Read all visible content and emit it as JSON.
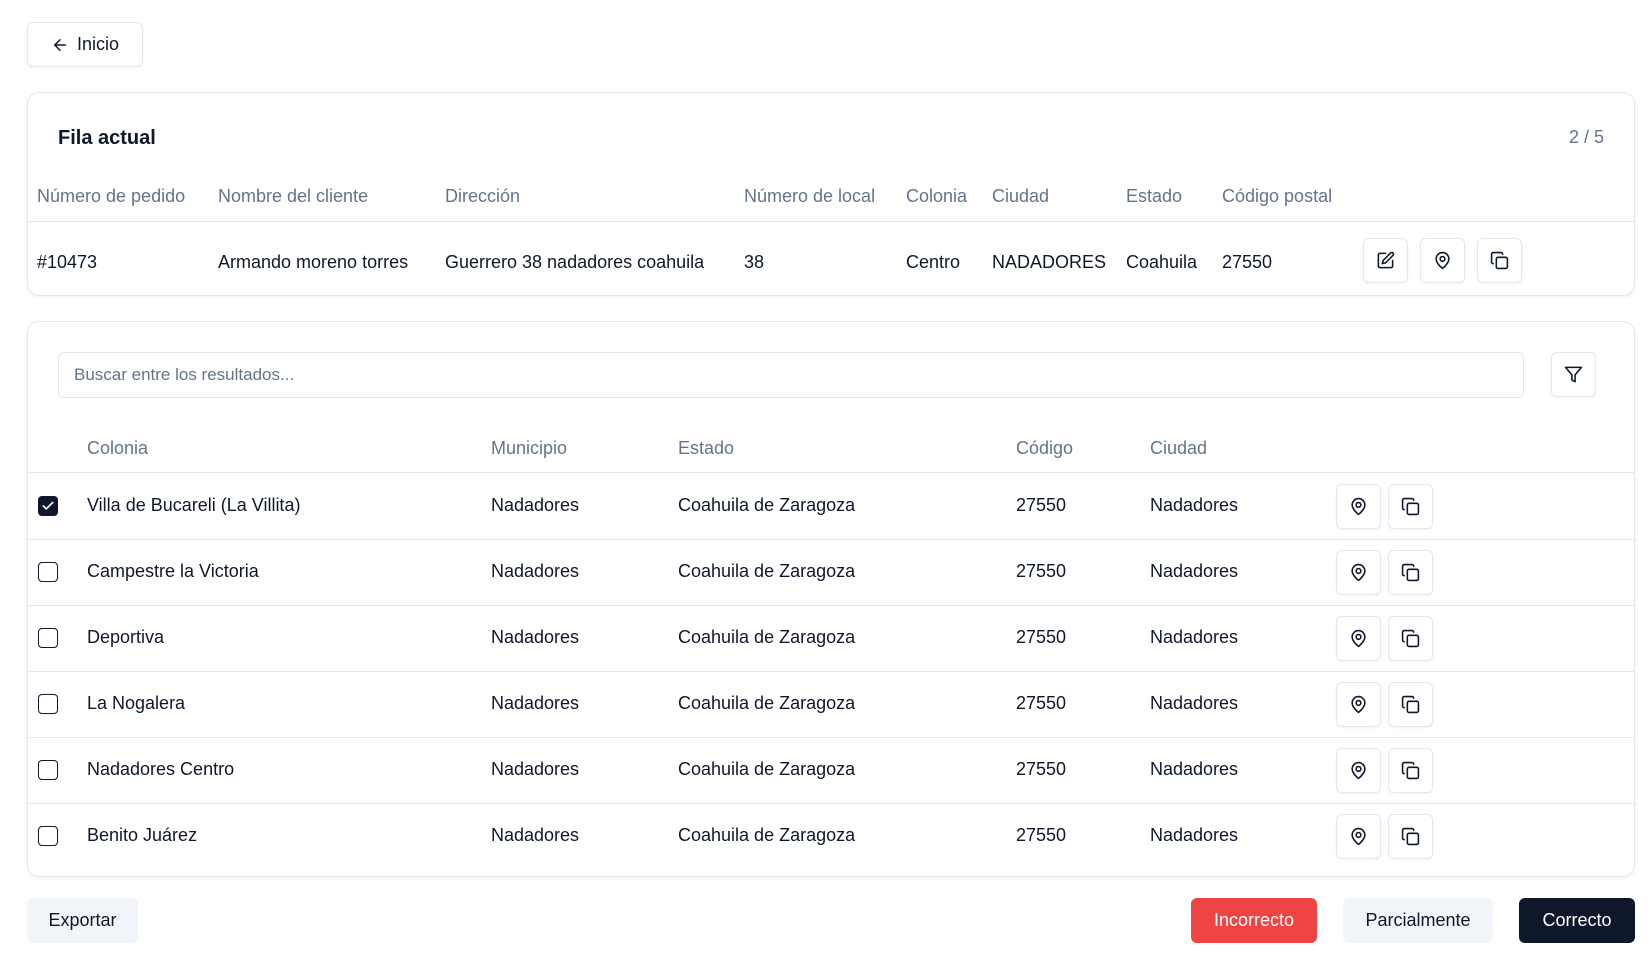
{
  "back": {
    "label": "Inicio",
    "icon": "arrow-left-icon"
  },
  "current": {
    "title": "Fila actual",
    "pager": "2 / 5",
    "columns": [
      "Número de pedido",
      "Nombre del cliente",
      "Dirección",
      "Número de local",
      "Colonia",
      "Ciudad",
      "Estado",
      "Código postal"
    ],
    "row": {
      "order": "#10473",
      "client": "Armando moreno torres",
      "address": "Guerrero 38 nadadores coahuila",
      "local": "38",
      "colonia": "Centro",
      "ciudad": "NADADORES",
      "estado": "Coahuila",
      "cp": "27550"
    },
    "actions": [
      "edit-icon",
      "map-pin-icon",
      "copy-icon"
    ]
  },
  "results": {
    "search_placeholder": "Buscar entre los resultados...",
    "filter_icon": "filter-icon",
    "columns": [
      "Colonia",
      "Municipio",
      "Estado",
      "Código",
      "Ciudad"
    ],
    "rows": [
      {
        "checked": true,
        "colonia": "Villa de Bucareli (La Villita)",
        "municipio": "Nadadores",
        "estado": "Coahuila de Zaragoza",
        "codigo": "27550",
        "ciudad": "Nadadores"
      },
      {
        "checked": false,
        "colonia": "Campestre la Victoria",
        "municipio": "Nadadores",
        "estado": "Coahuila de Zaragoza",
        "codigo": "27550",
        "ciudad": "Nadadores"
      },
      {
        "checked": false,
        "colonia": "Deportiva",
        "municipio": "Nadadores",
        "estado": "Coahuila de Zaragoza",
        "codigo": "27550",
        "ciudad": "Nadadores"
      },
      {
        "checked": false,
        "colonia": "La Nogalera",
        "municipio": "Nadadores",
        "estado": "Coahuila de Zaragoza",
        "codigo": "27550",
        "ciudad": "Nadadores"
      },
      {
        "checked": false,
        "colonia": "Nadadores Centro",
        "municipio": "Nadadores",
        "estado": "Coahuila de Zaragoza",
        "codigo": "27550",
        "ciudad": "Nadadores"
      },
      {
        "checked": false,
        "colonia": "Benito Juárez",
        "municipio": "Nadadores",
        "estado": "Coahuila de Zaragoza",
        "codigo": "27550",
        "ciudad": "Nadadores"
      }
    ]
  },
  "footer": {
    "export": "Exportar",
    "incorrect": "Incorrecto",
    "partial": "Parcialmente",
    "correct": "Correcto"
  },
  "colors": {
    "primary": "#0f172a",
    "danger": "#ef4444",
    "muted": "#64748b",
    "border": "#e2e8f0",
    "secondary_bg": "#f1f5f9"
  }
}
